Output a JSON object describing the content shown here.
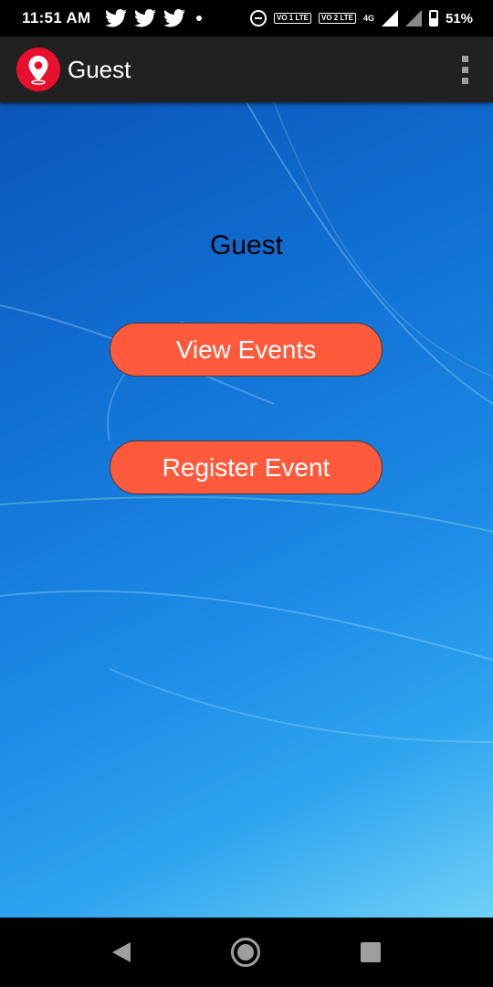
{
  "status_bar": {
    "time": "11:51 AM",
    "notification_icons": [
      "twitter-icon",
      "twitter-icon",
      "twitter-icon"
    ],
    "sim1_label": "VO 1 LTE",
    "sim2_label": "VO 2 LTE",
    "network_type": "4G",
    "battery_level": 0.51,
    "battery_text": "51%"
  },
  "app_bar": {
    "title": "Guest",
    "logo_icon": "map-pin-icon",
    "menu_icon": "more-vert-icon"
  },
  "main": {
    "heading": "Guest",
    "buttons": {
      "view_events": "View Events",
      "register_event": "Register Event"
    }
  },
  "nav_bar": {
    "back_icon": "back-icon",
    "home_icon": "home-icon",
    "recents_icon": "recents-icon"
  },
  "colors": {
    "accent_button": "#ff5a3c",
    "app_bar": "#212121",
    "logo": "#e8102e"
  }
}
